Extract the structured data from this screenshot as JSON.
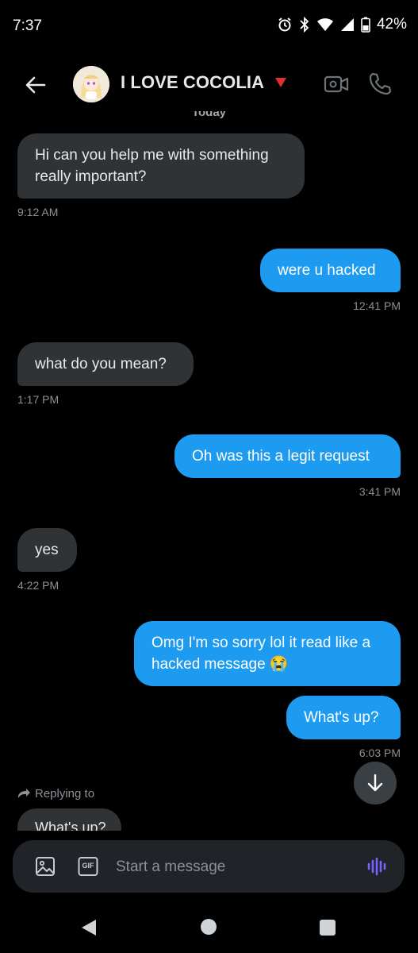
{
  "status_bar": {
    "time": "7:37",
    "battery": "42%"
  },
  "header": {
    "title": "I LOVE COCOLIA",
    "day_divider": "Today"
  },
  "messages": [
    {
      "side": "in",
      "text": "Hi can you help me with something really important?",
      "time": "9:12 AM"
    },
    {
      "side": "out",
      "text": "were u hacked",
      "time": "12:41 PM"
    },
    {
      "side": "in",
      "text": "what do you mean?",
      "time": "1:17 PM"
    },
    {
      "side": "out",
      "text": "Oh was this a legit request",
      "time": "3:41 PM"
    },
    {
      "side": "in",
      "text": "yes",
      "time": "4:22 PM"
    },
    {
      "side": "out",
      "text": "Omg I'm so sorry lol it read like a hacked message 😭",
      "time": ""
    },
    {
      "side": "out",
      "text": "What's up?",
      "time": "6:03 PM"
    }
  ],
  "reply": {
    "label": "Replying to",
    "preview": "What's up?"
  },
  "composer": {
    "placeholder": "Start a message",
    "gif_label": "GIF"
  },
  "colors": {
    "accent": "#1d9bf0",
    "incoming_bubble": "#2f3336",
    "voice": "#7b61ff",
    "flag": "#e0302b"
  },
  "icons": {
    "header": [
      "back-arrow-icon",
      "video-call-icon",
      "phone-icon"
    ],
    "composer": [
      "image-icon",
      "gif-icon",
      "voice-icon"
    ],
    "nav": [
      "nav-back-icon",
      "nav-home-icon",
      "nav-recents-icon"
    ]
  }
}
